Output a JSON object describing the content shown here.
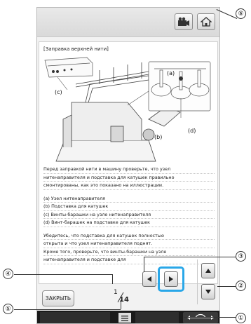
{
  "buttons": {
    "close_label": "ЗАКРЫТЬ"
  },
  "document": {
    "title": "[Заправка верхней нити]",
    "callouts": [
      "(a)",
      "(b)",
      "(c)",
      "(d)"
    ],
    "paragraph1": [
      "Перед заправкой нити в машину проверьте, что узел",
      "нитенаправителя и подставка для катушек правильно",
      "смонтированы, как это показано на иллюстрации."
    ],
    "legend": [
      "(a) Узел нитенаправителя",
      "(b) Подставка для катушек",
      "(c) Винты-барашки на узле нитенаправителя",
      "(d) Винт-барашек на подставке для катушек"
    ],
    "paragraph2": [
      "Убедитесь, что подставка для катушек полностью",
      "открыта и что узел нитенаправителя поднят.",
      "Кроме того, проверьте, что винты-барашки на узле",
      "нитенаправителя и подставке для"
    ]
  },
  "pagination": {
    "current": "1",
    "total": "14"
  },
  "annotations": {
    "n1": "①",
    "n2": "②",
    "n3": "③",
    "n4": "④",
    "n5": "⑤",
    "n6": "⑥"
  },
  "icons": {
    "video": "video-icon",
    "home": "home-icon",
    "page_left": "arrow-left-icon",
    "page_right": "arrow-right-icon",
    "scroll_up": "arrow-up-icon",
    "scroll_down": "arrow-down-icon"
  },
  "colors": {
    "highlight": "#29a7e8"
  }
}
